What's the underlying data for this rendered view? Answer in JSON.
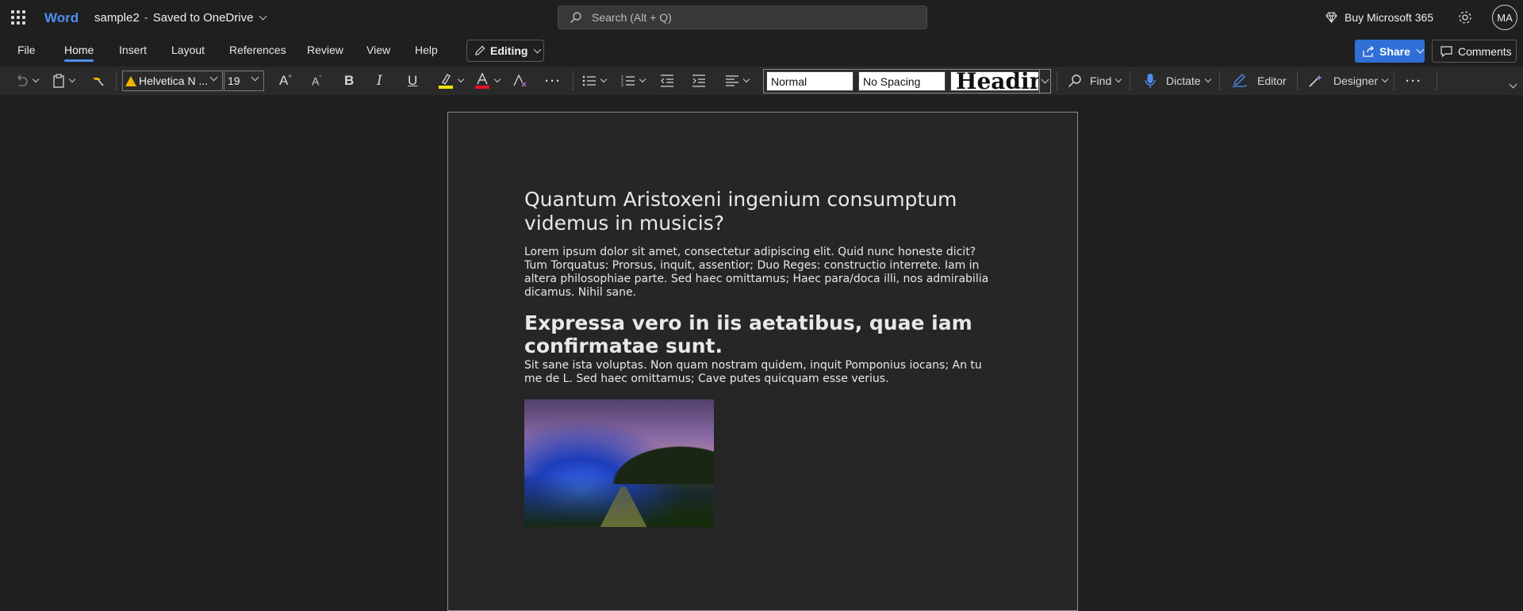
{
  "title_bar": {
    "app_name": "Word",
    "doc_name": "sample2",
    "separator": "-",
    "save_status": "Saved to OneDrive",
    "search_placeholder": "Search (Alt + Q)",
    "buy_label": "Buy Microsoft 365",
    "avatar_initials": "MA"
  },
  "menubar": {
    "tabs": [
      "File",
      "Home",
      "Insert",
      "Layout",
      "References",
      "Review",
      "View",
      "Help"
    ],
    "active_tab": "Home",
    "editing_label": "Editing",
    "share_label": "Share",
    "comments_label": "Comments"
  },
  "ribbon": {
    "font_name": "Helvetica N ...",
    "font_size": "19",
    "styles": [
      "Normal",
      "No Spacing",
      "Headin"
    ],
    "find_label": "Find",
    "dictate_label": "Dictate",
    "editor_label": "Editor",
    "designer_label": "Designer",
    "highlight_color": "#f5e400",
    "font_color": "#e81123",
    "accent": "#4f8ff0"
  },
  "document": {
    "heading1": "Quantum Aristoxeni ingenium consumptum videmus in musicis?",
    "para1": "Lorem ipsum dolor sit amet, consectetur adipiscing elit. Quid nunc honeste dicit? Tum Torquatus: Prorsus, inquit, assentior; Duo Reges: constructio interrete. Iam in altera philosophiae parte. Sed haec omittamus; Haec para/doca illi, nos admirabilia dicamus. Nihil sane.",
    "heading2": "Expressa vero in iis aetatibus, quae iam confirmatae sunt.",
    "para2": "Sit sane ista voluptas. Non quam nostram quidem, inquit Pomponius iocans; An tu me de L. Sed haec omittamus; Cave putes quicquam esse verius."
  }
}
